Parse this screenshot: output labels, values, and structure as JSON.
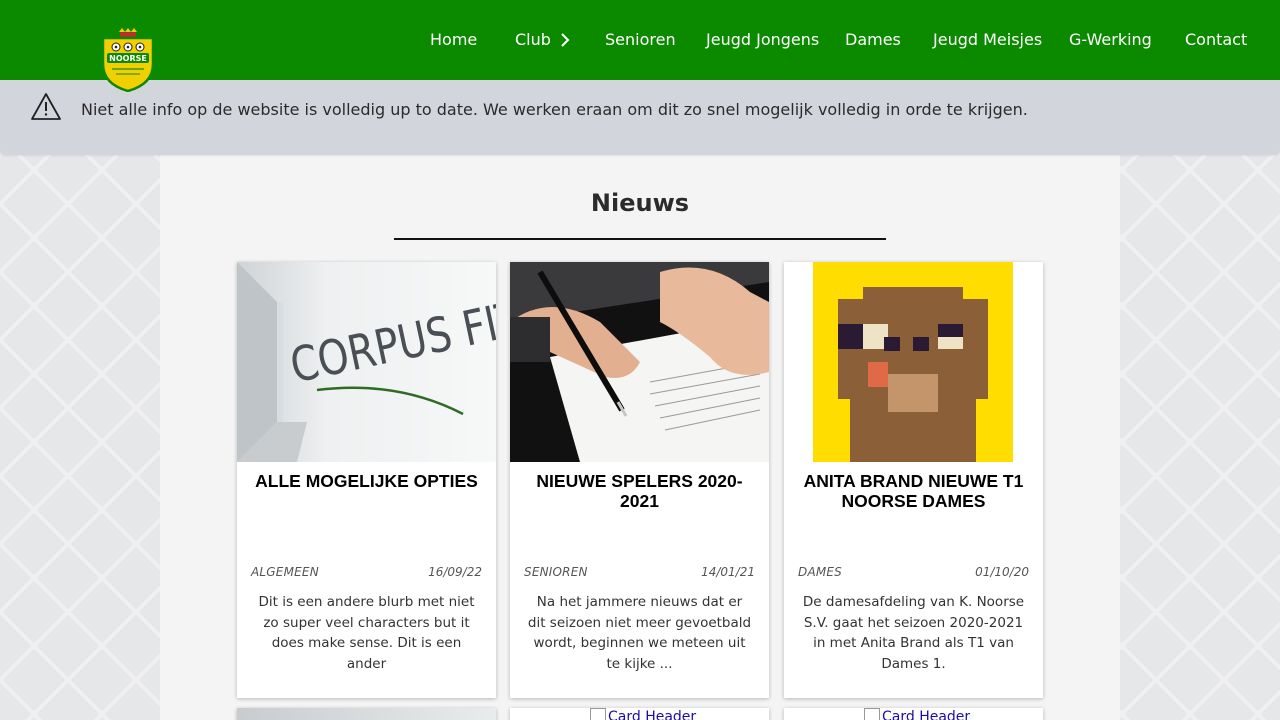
{
  "header": {
    "logo_alt": "K. Noorse logo",
    "nav": [
      {
        "label": "Home"
      },
      {
        "label": "Club"
      },
      {
        "label": "Senioren"
      },
      {
        "label": "Jeugd Jongens"
      },
      {
        "label": "Dames"
      },
      {
        "label": "Jeugd Meisjes"
      },
      {
        "label": "G-Werking"
      },
      {
        "label": "Contact"
      }
    ],
    "logo_text": "NOORSE"
  },
  "alert": {
    "text": "Niet alle info op de website is volledig up to date. We werken eraan om dit zo snel mogelijk volledig in orde te krijgen."
  },
  "news": {
    "title": "Nieuws",
    "cards": [
      {
        "title": "ALLE MOGELIJKE OPTIES",
        "category": "ALGEMEEN",
        "date": "16/09/22",
        "text": "Dit is een andere blurb met niet zo super veel characters but it does make sense. Dit is een ander",
        "image_text": "CORPUS FIT"
      },
      {
        "title": "NIEUWE SPELERS 2020-2021",
        "category": "SENIOREN",
        "date": "14/01/21",
        "text": "Na het jammere nieuws dat er dit seizoen niet meer gevoetbald wordt, beginnen we meteen uit te kijke ..."
      },
      {
        "title": "ANITA BRAND NIEUWE T1 NOORSE DAMES",
        "category": "DAMES",
        "date": "01/10/20",
        "text": "De damesafdeling van K. Noorse S.V. gaat het seizoen 2020-2021 in met Anita Brand als T1 van Dames 1."
      }
    ],
    "next_row": [
      {
        "image_alt": ""
      },
      {
        "image_alt": "Card Header"
      },
      {
        "image_alt": "Card Header"
      }
    ]
  },
  "colors": {
    "navbar": "#0b8a00",
    "alert_bg": "#d2d5dc",
    "main_bg": "#f4f4f4",
    "card_bg": "#ffffff",
    "logo_yellow": "#f2cf00",
    "pixel_art_yellow": "#ffdd00",
    "pixel_art_brown": "#8b6039"
  },
  "icons": {
    "alert": "warning-triangle-icon",
    "club_submenu": "chevron-right-icon"
  }
}
